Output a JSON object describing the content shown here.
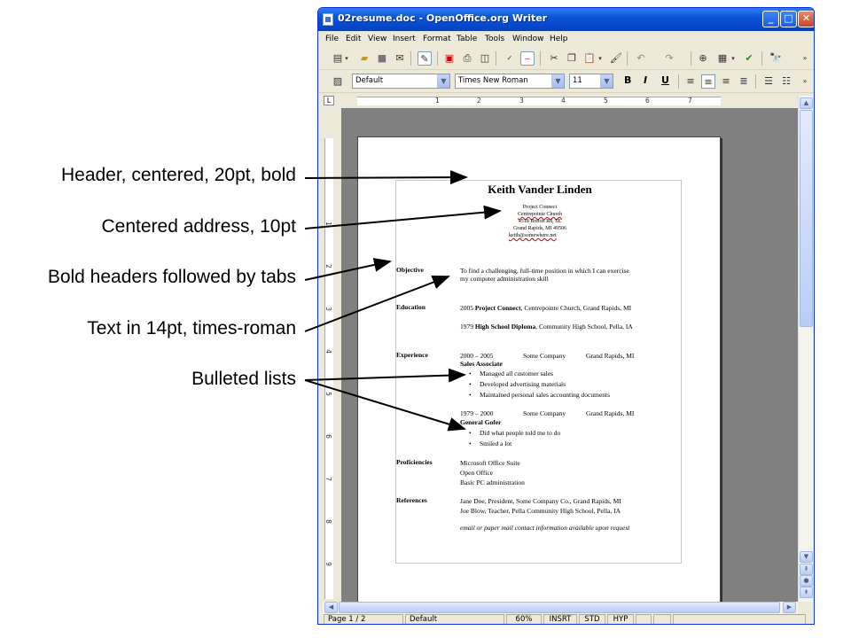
{
  "annotations": [
    "Header, centered, 20pt, bold",
    "Centered address, 10pt",
    "Bold headers followed by tabs",
    "Text in 14pt, times-roman",
    "Bulleted lists"
  ],
  "window": {
    "title": "02resume.doc - OpenOffice.org Writer",
    "menus": [
      "File",
      "Edit",
      "View",
      "Insert",
      "Format",
      "Table",
      "Tools",
      "Window",
      "Help"
    ],
    "paragraph_style": "Default",
    "font_name": "Times New Roman",
    "font_size": "11"
  },
  "ruler_numbers": [
    "1",
    "2",
    "3",
    "4",
    "5",
    "6",
    "7"
  ],
  "vruler_numbers": [
    "1",
    "2",
    "3",
    "4",
    "5",
    "6",
    "7",
    "8",
    "9"
  ],
  "resume": {
    "name": "Keith Vander Linden",
    "address": [
      "Project Connect",
      "Centrepointe Church",
      "4518 Breton Rd, SE",
      "Grand Rapids, MI 49506",
      "keith@somewhere.net"
    ],
    "objective_label": "Objective",
    "objective_text": [
      "To find a challenging, full-time position in which I can exercise",
      "my computer administration skill"
    ],
    "education_label": "Education",
    "edu1_year": "2005",
    "edu1_bold": "Project Connect",
    "edu1_rest": "Centrepointe Church, Grand Rapids, MI",
    "edu2_year": "1979",
    "edu2_bold": "High School Diploma",
    "edu2_rest": "Community High School, Pella, IA",
    "experience_label": "Experience",
    "job1_dates": "2000 – 2005",
    "job1_company": "Some Company",
    "job1_location": "Grand Rapids, MI",
    "job1_title": "Sales Associate",
    "job1_bullets": [
      "Managed all customer sales",
      "Developed advertising materials",
      "Maintained personal sales accounting documents"
    ],
    "job2_dates": "1979 – 2000",
    "job2_company": "Some Company",
    "job2_location": "Grand Rapids, MI",
    "job2_title": "General Gofer",
    "job2_bullets": [
      "Did what people told me to do",
      "Smiled a lot"
    ],
    "proficiencies_label": "Proficiencies",
    "proficiencies": [
      "Microsoft Office Suite",
      "Open Office",
      "Basic PC administration"
    ],
    "references_label": "References",
    "references": [
      "Jane Doe, President, Some Company Co., Grand Rapids, MI",
      "Joe Blow, Teacher, Pella Community High School, Pella, IA"
    ],
    "references_note": "email or paper mail contact information available upon request"
  },
  "status": {
    "page": "Page 1 / 2",
    "style": "Default",
    "zoom": "60%",
    "mode": "INSRT",
    "selection": "STD",
    "hyperlink": "HYP"
  }
}
